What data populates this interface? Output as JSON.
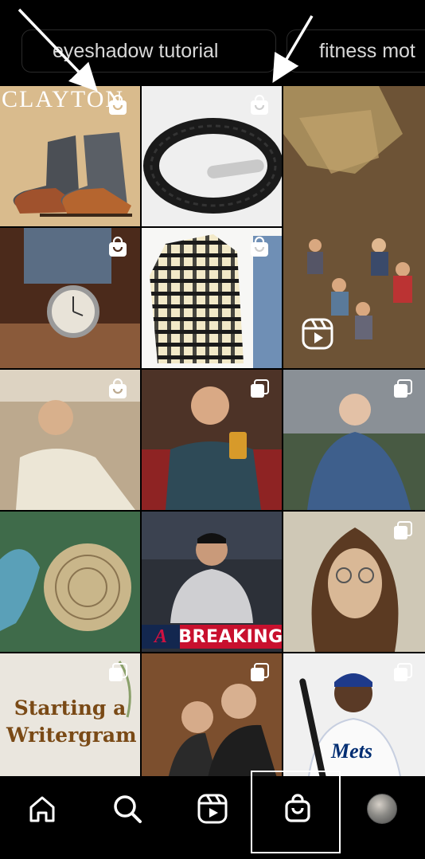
{
  "search_chips": [
    {
      "label": "eyeshadow tutorial"
    },
    {
      "label": "fitness mot"
    }
  ],
  "grid": {
    "tiles": [
      {
        "overlay_text": "CLAYTON",
        "indicator": "shopping-bag"
      },
      {
        "indicator": "shopping-bag"
      },
      {
        "indicator": "none"
      },
      {
        "indicator": "shopping-bag"
      },
      {
        "indicator": "shopping-bag"
      },
      {
        "indicator": "reel"
      },
      {
        "indicator": "shopping-bag"
      },
      {
        "indicator": "multiple"
      },
      {
        "indicator": "multiple"
      },
      {
        "indicator": "none"
      },
      {
        "overlay_text": "BREAKING",
        "indicator": "none"
      },
      {
        "indicator": "multiple"
      },
      {
        "overlay_text": "Starting a writergram",
        "indicator": "multiple"
      },
      {
        "indicator": "multiple"
      },
      {
        "indicator": "multiple"
      },
      {
        "overlay_text": "Mets",
        "indicator": "multiple"
      }
    ]
  },
  "bottom_nav": {
    "items": [
      {
        "icon": "home-icon"
      },
      {
        "icon": "search-icon"
      },
      {
        "icon": "reels-icon"
      },
      {
        "icon": "shop-icon",
        "selected": true
      },
      {
        "icon": "profile-avatar"
      }
    ]
  },
  "colors": {
    "background": "#000000",
    "chip_border": "#2a2a2a",
    "chip_text": "#d8d8d8",
    "icon": "#ffffff"
  }
}
